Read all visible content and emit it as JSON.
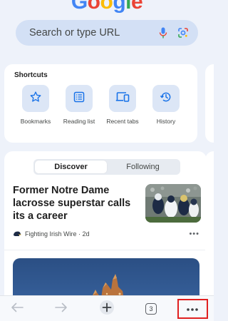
{
  "logo": {
    "text": "Google",
    "letter_colors": [
      "#4285f4",
      "#ea4335",
      "#fbbc05",
      "#4285f4",
      "#34a853",
      "#ea4335"
    ]
  },
  "search": {
    "placeholder": "Search or type URL",
    "mic_icon": "mic-icon",
    "lens_icon": "lens-icon"
  },
  "shortcuts": {
    "title": "Shortcuts",
    "items": [
      {
        "label": "Bookmarks",
        "icon": "star-icon"
      },
      {
        "label": "Reading list",
        "icon": "list-icon"
      },
      {
        "label": "Recent tabs",
        "icon": "devices-icon"
      },
      {
        "label": "History",
        "icon": "history-icon"
      }
    ]
  },
  "feed": {
    "tabs": [
      {
        "label": "Discover",
        "active": true
      },
      {
        "label": "Following",
        "active": false
      }
    ],
    "articles": [
      {
        "title": "Former Notre Dame lacrosse superstar calls its a career",
        "source": "Fighting Irish Wire",
        "age": "2d",
        "more_icon": "more-horiz-icon"
      }
    ]
  },
  "toolbar": {
    "back_icon": "back-arrow-icon",
    "forward_icon": "forward-arrow-icon",
    "new_tab_icon": "plus-icon",
    "tab_count": "3",
    "menu_icon": "more-horiz-icon",
    "menu_highlighted": true
  },
  "colors": {
    "accent": "#1a73e8",
    "background": "#eef2fa",
    "search_bg": "#d3e0f5",
    "tile_bg": "#dce6f6",
    "highlight": "#e02020"
  }
}
